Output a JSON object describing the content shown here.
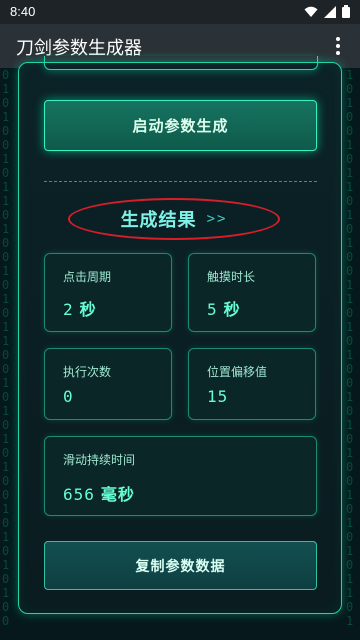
{
  "status_bar": {
    "time": "8:40"
  },
  "app_bar": {
    "title": "刀剑参数生成器"
  },
  "actions": {
    "start_label": "启动参数生成",
    "copy_label": "复制参数数据"
  },
  "result": {
    "title": "生成结果",
    "arrows": ">>"
  },
  "stats": {
    "click_period": {
      "label": "点击周期",
      "value": "2",
      "unit": "秒"
    },
    "touch_duration": {
      "label": "触摸时长",
      "value": "5",
      "unit": "秒"
    },
    "exec_count": {
      "label": "执行次数",
      "value": "0"
    },
    "offset": {
      "label": "位置偏移值",
      "value": "15"
    },
    "swipe_duration": {
      "label": "滑动持续时间",
      "value": "656",
      "unit": "毫秒"
    }
  },
  "colors": {
    "accent": "#1fd6a6",
    "highlight_circle": "#d91e2a",
    "background": "#06181c"
  }
}
